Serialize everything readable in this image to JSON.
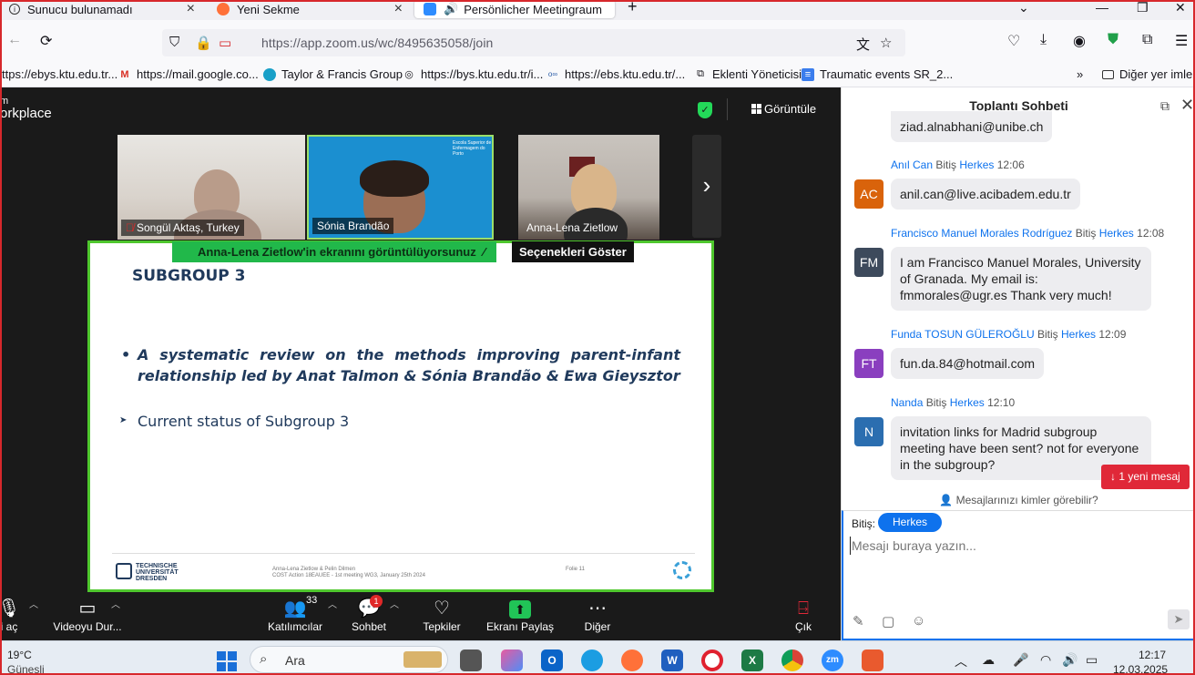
{
  "browser": {
    "tabs": [
      {
        "title": "Sunucu bulunamadı",
        "active": false
      },
      {
        "title": "Yeni Sekme",
        "active": false
      },
      {
        "title": "Persönlicher Meetingraum",
        "active": true
      }
    ],
    "url": "https://app.zoom.us/wc/8495635058/join",
    "bookmarks": [
      "ttps://ebys.ktu.edu.tr...",
      "https://mail.google.co...",
      "Taylor & Francis Group",
      "https://bys.ktu.edu.tr/i...",
      "https://ebs.ktu.edu.tr/...",
      "Eklenti Yöneticisi",
      "Traumatic events SR_2...",
      "Diğer yer imleri"
    ]
  },
  "zoom": {
    "brand_line1": "m",
    "brand_line2": "orkplace",
    "view_label": "Görüntüle",
    "participants": [
      {
        "name": "Songül Aktaş, Turkey",
        "muted": true
      },
      {
        "name": "Sónia Brandão",
        "muted": false
      },
      {
        "name": "Anna-Lena Zietlow",
        "muted": false
      }
    ],
    "tile2_logo_text": "Escola Superior de Enfermagem do Porto",
    "share_banner": "Anna-Lena Zietlow'in ekranını görüntülüyorsunuz",
    "options_label": "Seçenekleri Göster",
    "slide": {
      "title": "SUBGROUP 3",
      "bullet1": "A systematic review on the methods improving parent-infant relationship led by Anat Talmon & Sónia Brandão & Ewa Gieysztor",
      "bullet2": "Current status of Subgroup 3",
      "logo_line1": "TECHNISCHE",
      "logo_line2": "UNIVERSITÄT",
      "logo_line3": "DRESDEN",
      "footer_line1": "Anna-Lena Zietlow & Pelin Dilmen",
      "footer_line2": "COST Action 18EAUEE - 1st meeting WG3, January 25th 2024",
      "folio": "Folie 11"
    },
    "toolbar": {
      "audio_label": "i aç",
      "video_label": "Videoyu Dur...",
      "participants_label": "Katılımcılar",
      "participants_count": "33",
      "chat_label": "Sohbet",
      "chat_badge": "1",
      "reactions_label": "Tepkiler",
      "share_label": "Ekranı Paylaş",
      "more_label": "Diğer",
      "leave_label": "Çık"
    }
  },
  "chat": {
    "title": "Toplantı Sohbeti",
    "first_partial": "ziad.alnabhani@unibe.ch",
    "messages": [
      {
        "sender": "Anıl Can",
        "to_prefix": "Bitiş",
        "to": "Herkes",
        "time": "12:06",
        "initials": "AC",
        "color": "#d9630b",
        "text": "anil.can@live.acibadem.edu.tr"
      },
      {
        "sender": "Francisco Manuel Morales Rodríguez",
        "to_prefix": "Bitiş",
        "to": "Herkes",
        "time": "12:08",
        "initials": "FM",
        "color": "#3d4a5c",
        "text": "I am Francisco Manuel Morales, University of Granada. My email is: fmmorales@ugr.es Thank very much!"
      },
      {
        "sender": "Funda TOSUN GÜLEROĞLU",
        "to_prefix": "Bitiş",
        "to": "Herkes",
        "time": "12:09",
        "initials": "FT",
        "color": "#8a3fbf",
        "text": "fun.da.84@hotmail.com"
      },
      {
        "sender": "Nanda",
        "to_prefix": "Bitiş",
        "to": "Herkes",
        "time": "12:10",
        "initials": "N",
        "color": "#2b6eb0",
        "text": "invitation links for Madrid subgroup meeting have been sent? not for everyone in the subgroup?"
      }
    ],
    "new_message_label": "↓ 1 yeni mesaj",
    "who_sees_label": "Mesajlarınızı kimler görebilir?",
    "compose_to_label": "Bitiş:",
    "compose_recipient": "Herkes",
    "compose_placeholder": "Mesajı buraya yazın..."
  },
  "taskbar": {
    "weather_temp": "19°C",
    "weather_desc": "Güneşli",
    "search_label": "Ara",
    "time": "12:17",
    "date": "12.03.2025"
  },
  "colors": {
    "zoom_bg": "#1a1a1a",
    "share_green": "#21b84a",
    "accent_blue": "#0e72ed",
    "alert_red": "#e02838"
  }
}
